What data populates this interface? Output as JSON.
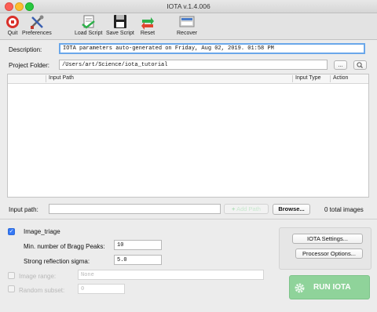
{
  "window": {
    "title": "IOTA v.1.4.006"
  },
  "toolbar": {
    "quit": "Quit",
    "preferences": "Preferences",
    "load_script": "Load Script",
    "save_script": "Save Script",
    "reset": "Reset",
    "recover": "Recover"
  },
  "form": {
    "description_label": "Description:",
    "description_value": "IOTA parameters auto-generated on Friday, Aug 02, 2019. 01:58 PM",
    "project_folder_label": "Project Folder:",
    "project_folder_value": "/Users/art/Science/iota_tutorial",
    "browse_dots": "..."
  },
  "table": {
    "columns": [
      "Input Path",
      "Input Type",
      "Action"
    ]
  },
  "input_path": {
    "label": "Input path:",
    "add_button": "Add Path",
    "browse_button": "Browse...",
    "total": "0 total images"
  },
  "triage": {
    "label": "Image_triage",
    "bragg_label": "Min. number of Bragg Peaks:",
    "bragg_value": "10",
    "sigma_label": "Strong reflection sigma:",
    "sigma_value": "5.0"
  },
  "image_range": {
    "label": "Image range:",
    "value": "None"
  },
  "random_subset": {
    "label": "Random subset:",
    "value": "0"
  },
  "buttons": {
    "iota_settings": "IOTA Settings...",
    "processor_options": "Processor Options...",
    "run": "RUN IOTA"
  },
  "colors": {
    "accent": "#3478f6",
    "run_button": "#8fd39a",
    "focus": "#6aa7ea"
  }
}
